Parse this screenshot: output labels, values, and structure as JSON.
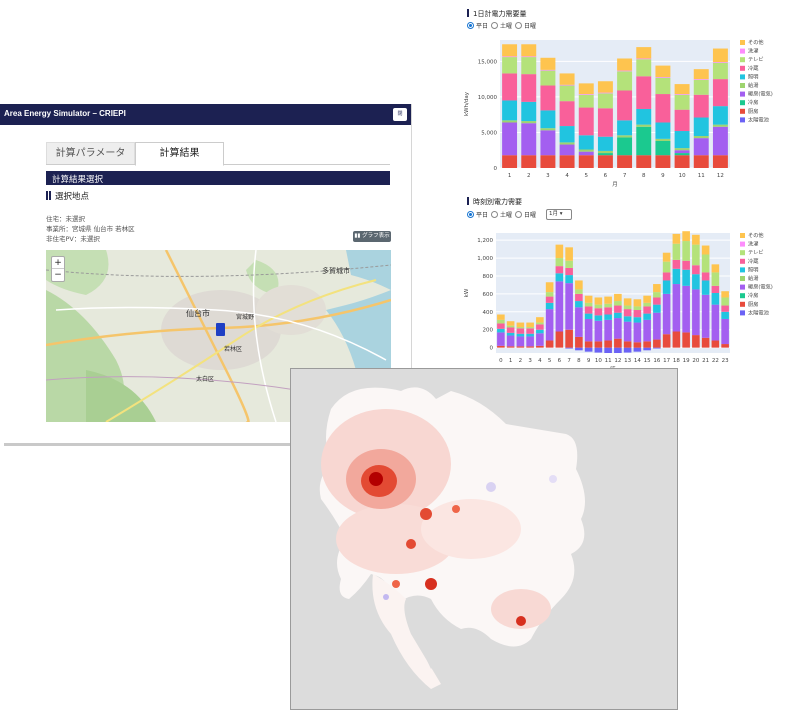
{
  "app": {
    "title": "Area Energy Simulator – CRIEPI",
    "header_button": "閉",
    "tabs": [
      {
        "label": "計算パラメータ",
        "active": false
      },
      {
        "label": "計算結果",
        "active": true
      }
    ],
    "section_title": "計算結果選択",
    "subheading": "選択地点",
    "info": [
      "住宅：未選択",
      "事業所：宮城県 仙台市 若林区",
      "非住宅PV：未選択"
    ],
    "graph_button": "グラフ表示",
    "map": {
      "zoom_in": "+",
      "zoom_out": "−",
      "labels": [
        "仙台市",
        "多賀城市",
        "宮城野",
        "若林区",
        "太白区"
      ]
    }
  },
  "colors": {
    "navy": "#1c2152",
    "sono_ta": "#fec44f",
    "sentaku": "#fd8dfc",
    "tv": "#b4e27a",
    "reizo": "#f9609a",
    "shomei": "#21c4e0",
    "kyuto": "#9ed46f",
    "danbo": "#a35ff0",
    "reibo": "#1bc98f",
    "chubo": "#e84b3c",
    "pv": "#6b62f5",
    "plot_bg": "#e5ecf6"
  },
  "daily_chart": {
    "title": "1日計電力需要量",
    "radios": [
      {
        "label": "平日",
        "selected": true
      },
      {
        "label": "土曜",
        "selected": false
      },
      {
        "label": "日曜",
        "selected": false
      }
    ]
  },
  "hourly_chart": {
    "title": "時刻別電力需要",
    "radios": [
      {
        "label": "平日",
        "selected": true
      },
      {
        "label": "土曜",
        "selected": false
      },
      {
        "label": "日曜",
        "selected": false
      }
    ],
    "month_select": "1月 ▾"
  },
  "chart_data": [
    {
      "type": "bar",
      "stacked": true,
      "xlabel": "月",
      "ylabel": "kWh/day",
      "ylim": [
        0,
        18000
      ],
      "yticks": [
        "0",
        "5,000",
        "10,000",
        "15,000"
      ],
      "categories": [
        "1",
        "2",
        "3",
        "4",
        "5",
        "6",
        "7",
        "8",
        "9",
        "10",
        "11",
        "12"
      ],
      "legend": [
        "その他",
        "洗濯",
        "テレビ",
        "冷蔵",
        "照明",
        "給湯",
        "暖房(電気)",
        "冷房",
        "厨房",
        "太陽電池"
      ],
      "series": [
        {
          "name": "太陽電池",
          "color": "#6b62f5",
          "values": [
            0,
            0,
            0,
            0,
            0,
            0,
            0,
            0,
            0,
            0,
            0,
            0
          ]
        },
        {
          "name": "厨房",
          "color": "#e84b3c",
          "values": [
            1800,
            1800,
            1800,
            1800,
            1800,
            1800,
            1800,
            1800,
            1800,
            1800,
            1800,
            1800
          ]
        },
        {
          "name": "冷房",
          "color": "#1bc98f",
          "values": [
            0,
            0,
            0,
            0,
            0,
            300,
            2500,
            4000,
            2000,
            300,
            0,
            0
          ]
        },
        {
          "name": "暖房(電気)",
          "color": "#a35ff0",
          "values": [
            4600,
            4500,
            3500,
            1500,
            500,
            0,
            0,
            0,
            0,
            400,
            2400,
            4000
          ]
        },
        {
          "name": "給湯",
          "color": "#9ed46f",
          "values": [
            300,
            300,
            300,
            300,
            300,
            300,
            300,
            300,
            300,
            300,
            300,
            300
          ]
        },
        {
          "name": "照明",
          "color": "#21c4e0",
          "values": [
            2800,
            2700,
            2500,
            2300,
            2000,
            2000,
            2100,
            2200,
            2300,
            2400,
            2600,
            2600
          ]
        },
        {
          "name": "冷蔵",
          "color": "#f9609a",
          "values": [
            3800,
            3900,
            3500,
            3500,
            3900,
            4000,
            4200,
            4600,
            4000,
            3000,
            3200,
            3800
          ]
        },
        {
          "name": "テレビ",
          "color": "#b4e27a",
          "values": [
            2300,
            2400,
            2100,
            2200,
            1800,
            2100,
            2700,
            2400,
            2300,
            2100,
            2100,
            2300
          ]
        },
        {
          "name": "洗濯",
          "color": "#fd8dfc",
          "values": [
            100,
            100,
            100,
            100,
            100,
            100,
            100,
            100,
            100,
            100,
            100,
            100
          ]
        },
        {
          "name": "その他",
          "color": "#fec44f",
          "values": [
            1700,
            1700,
            1700,
            1600,
            1500,
            1600,
            1700,
            1600,
            1600,
            1400,
            1400,
            1900
          ]
        }
      ]
    },
    {
      "type": "bar",
      "stacked": true,
      "xlabel": "時",
      "ylabel": "kW",
      "ylim": [
        -60,
        1280
      ],
      "yticks": [
        "0",
        "200",
        "400",
        "600",
        "800",
        "1,000",
        "1,200"
      ],
      "categories": [
        "0",
        "1",
        "2",
        "3",
        "4",
        "5",
        "6",
        "7",
        "8",
        "9",
        "10",
        "11",
        "12",
        "13",
        "14",
        "15",
        "16",
        "17",
        "18",
        "19",
        "20",
        "21",
        "22",
        "23"
      ],
      "legend": [
        "その他",
        "洗濯",
        "テレビ",
        "冷蔵",
        "照明",
        "給湯",
        "暖房(電気)",
        "冷房",
        "厨房",
        "太陽電池"
      ],
      "series": [
        {
          "name": "太陽電池",
          "color": "#6b62f5",
          "values": [
            0,
            0,
            0,
            0,
            0,
            0,
            0,
            -10,
            -30,
            -45,
            -55,
            -60,
            -60,
            -55,
            -45,
            -30,
            -10,
            0,
            0,
            0,
            0,
            0,
            0,
            0
          ]
        },
        {
          "name": "厨房",
          "color": "#e84b3c",
          "values": [
            20,
            15,
            15,
            15,
            20,
            80,
            180,
            200,
            120,
            70,
            70,
            80,
            100,
            70,
            60,
            70,
            90,
            150,
            180,
            170,
            140,
            110,
            80,
            40
          ]
        },
        {
          "name": "暖房(電気)",
          "color": "#a35ff0",
          "values": [
            150,
            120,
            110,
            110,
            140,
            350,
            560,
            520,
            330,
            250,
            230,
            230,
            230,
            220,
            220,
            240,
            300,
            450,
            530,
            520,
            510,
            480,
            400,
            280
          ]
        },
        {
          "name": "照明",
          "color": "#21c4e0",
          "values": [
            40,
            30,
            30,
            30,
            40,
            70,
            90,
            90,
            70,
            60,
            60,
            60,
            60,
            60,
            60,
            70,
            90,
            150,
            170,
            180,
            170,
            160,
            130,
            80
          ]
        },
        {
          "name": "冷蔵",
          "color": "#f9609a",
          "values": [
            60,
            60,
            60,
            60,
            60,
            70,
            80,
            80,
            80,
            80,
            80,
            80,
            80,
            80,
            80,
            80,
            80,
            90,
            100,
            100,
            100,
            90,
            80,
            70
          ]
        },
        {
          "name": "テレビ",
          "color": "#b4e27a",
          "values": [
            40,
            20,
            15,
            15,
            20,
            50,
            90,
            80,
            50,
            40,
            40,
            40,
            50,
            40,
            40,
            40,
            60,
            120,
            180,
            220,
            230,
            200,
            150,
            90
          ]
        },
        {
          "name": "その他",
          "color": "#fec44f",
          "values": [
            60,
            50,
            50,
            50,
            60,
            110,
            150,
            150,
            100,
            80,
            80,
            80,
            80,
            80,
            80,
            80,
            90,
            100,
            110,
            110,
            110,
            100,
            90,
            70
          ]
        }
      ]
    }
  ]
}
